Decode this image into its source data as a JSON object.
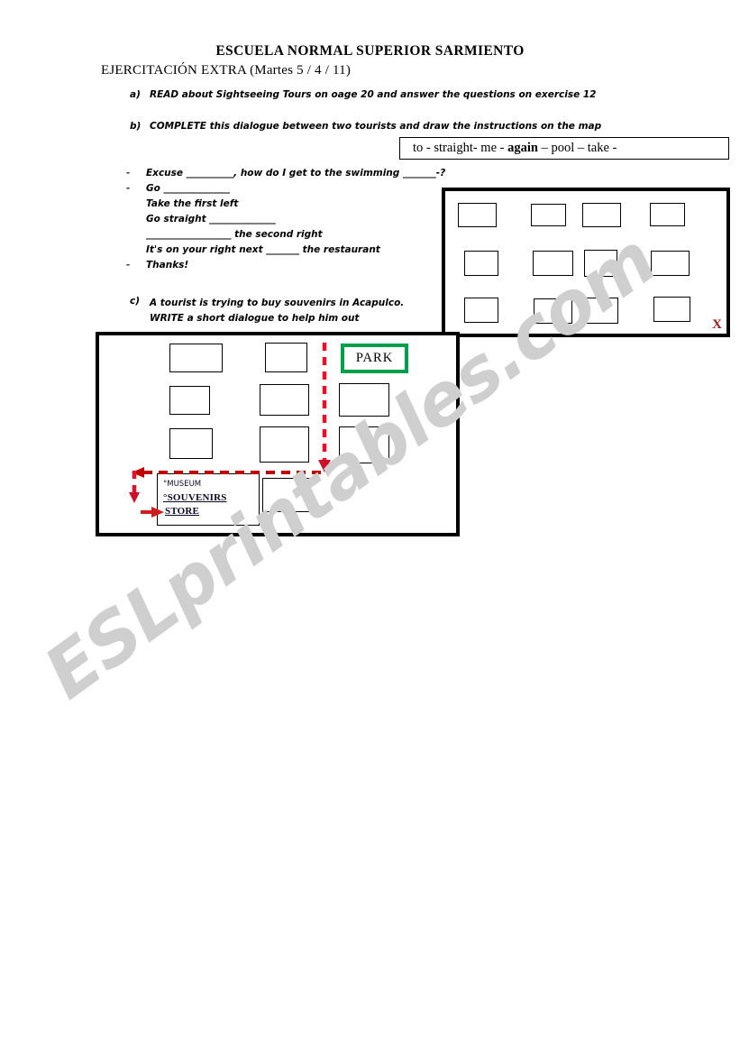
{
  "header": {
    "school_title": "ESCUELA NORMAL SUPERIOR SARMIENTO",
    "subtitle": "EJERCITACIÓN EXTRA (Martes 5 / 4 / 11)"
  },
  "exercises": [
    {
      "letter": "a)",
      "text": "READ about Sightseeing Tours on oage 20 and answer the questions on exercise 12"
    },
    {
      "letter": "b)",
      "text": "COMPLETE this dialogue between two tourists and draw the instructions on the map"
    },
    {
      "letter": "c)",
      "line1": "A tourist is trying to buy souvenirs in Acapulco.",
      "line2": "WRITE a short dialogue to help him out"
    }
  ],
  "word_bank": {
    "before": "to - straight- me -  ",
    "bold": "again",
    "after": " – pool – take -",
    "words": [
      "to",
      "straight",
      "me",
      "again",
      "pool",
      "take"
    ]
  },
  "dialogue": [
    {
      "dash": "-",
      "text": "Excuse __________, how do I get to the swimming _______-?"
    },
    {
      "dash": "-",
      "text": "Go ______________"
    },
    {
      "dash": "",
      "text": "Take the first left"
    },
    {
      "dash": "",
      "text": "Go straight ______________"
    },
    {
      "dash": "",
      "text": "__________________ the second right"
    },
    {
      "dash": "",
      "text": "It's on your right next _______ the restaurant"
    },
    {
      "dash": "-",
      "text": "Thanks!"
    }
  ],
  "map_top": {
    "marker": "X",
    "buildings_count": 12
  },
  "map_bottom": {
    "park_label": "PARK",
    "place_box": {
      "museum": "°MUSEUM",
      "souvenirs": "°SOUVENIRS",
      "store": "STORE"
    }
  },
  "watermark": {
    "text": "ESLprintables.com"
  },
  "colors": {
    "park_green": "#00a04a",
    "marker_red": "#9b1b1b",
    "route_red_bright": "#e8112d",
    "route_red_dark": "#c00000",
    "watermark_gray": "#cfcfcf",
    "ink_black": "#000000"
  }
}
